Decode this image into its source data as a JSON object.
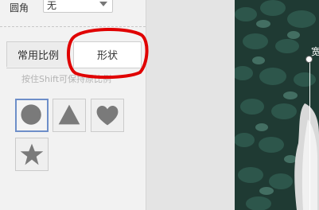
{
  "crop_panel": {
    "radius_label": "圆角",
    "radius_value": "无",
    "tabs": [
      {
        "label": "常用比例",
        "active": false
      },
      {
        "label": "形状",
        "active": true
      }
    ],
    "hint": "按住Shift可保持原比例",
    "shapes": [
      {
        "icon": "circle-icon",
        "selected": true
      },
      {
        "icon": "triangle-icon",
        "selected": false
      },
      {
        "icon": "heart-icon",
        "selected": false
      },
      {
        "icon": "star-icon",
        "selected": false
      }
    ]
  },
  "canvas": {
    "guide_label": "宽"
  },
  "colors": {
    "shape_fill": "#7a7a7a",
    "selected_border": "#6e8fc9",
    "annotation": "#e00000"
  }
}
